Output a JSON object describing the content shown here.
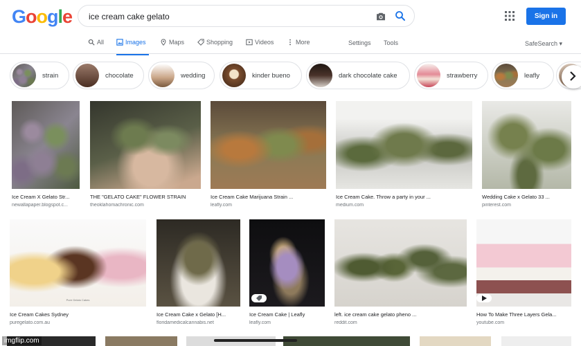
{
  "search": {
    "query": "ice cream cake gelato"
  },
  "header": {
    "logo_letters": [
      {
        "ch": "G",
        "color": "#4285f4"
      },
      {
        "ch": "o",
        "color": "#ea4335"
      },
      {
        "ch": "o",
        "color": "#fbbc05"
      },
      {
        "ch": "g",
        "color": "#4285f4"
      },
      {
        "ch": "l",
        "color": "#34a853"
      },
      {
        "ch": "e",
        "color": "#ea4335"
      }
    ],
    "sign_in_label": "Sign in"
  },
  "tabs": [
    {
      "label": "All",
      "icon": "search-icon",
      "active": false
    },
    {
      "label": "Images",
      "icon": "image-icon",
      "active": true
    },
    {
      "label": "Maps",
      "icon": "pin-icon",
      "active": false
    },
    {
      "label": "Shopping",
      "icon": "tag-icon",
      "active": false
    },
    {
      "label": "Videos",
      "icon": "play-icon",
      "active": false
    },
    {
      "label": "More",
      "icon": "more-dots-icon",
      "active": false
    }
  ],
  "tools": {
    "settings": "Settings",
    "tools": "Tools",
    "safesearch": "SafeSearch"
  },
  "chips": [
    {
      "label": "strain",
      "thumb_color": "#6f6a6e"
    },
    {
      "label": "chocolate",
      "thumb_color": "#6b4a3c"
    },
    {
      "label": "wedding",
      "thumb_color": "#c9a587"
    },
    {
      "label": "kinder bueno",
      "thumb_color": "#7a4d2e"
    },
    {
      "label": "dark chocolate cake",
      "thumb_color": "#3c2a22"
    },
    {
      "label": "strawberry",
      "thumb_color": "#d46a78"
    },
    {
      "label": "leafly",
      "thumb_color": "#7d7a55"
    }
  ],
  "results_row1": [
    {
      "caption": "Ice Cream X Gelato Str...",
      "source": "newallapaper.blogspot.c..."
    },
    {
      "caption": "THE \"GELATO CAKE\" FLOWER STRAIN",
      "source": "theoklahomachronic.com"
    },
    {
      "caption": "Ice Cream Cake Marijuana Strain ...",
      "source": "leafly.com"
    },
    {
      "caption": "Ice Cream Cake. Throw a party in your ...",
      "source": "medium.com"
    },
    {
      "caption": "Wedding Cake x Gelato 33 ...",
      "source": "pinterest.com"
    }
  ],
  "results_row2": [
    {
      "caption": "Ice Cream Cakes Sydney",
      "source": "puregelato.com.au",
      "overlay": "Pure Gelato Cakes"
    },
    {
      "caption": "Ice Cream Cake x Gelato [H...",
      "source": "floridamedicalcannabis.net"
    },
    {
      "caption": "Ice Cream Cake | Leafly",
      "source": "leafly.com"
    },
    {
      "caption": "left. ice cream cake gelato pheno ...",
      "source": "reddit.com"
    },
    {
      "caption": "How To Make Three Layers Gela...",
      "source": "youtube.com"
    }
  ],
  "watermark": "imgflip.com"
}
